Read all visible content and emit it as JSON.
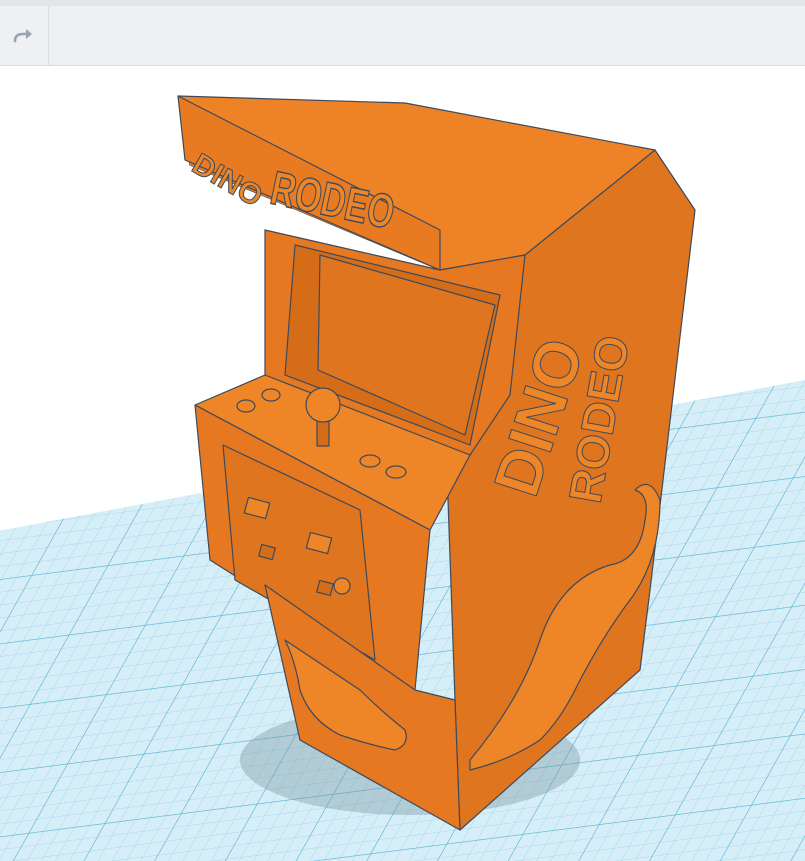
{
  "toolbar": {
    "redo_icon": "redo-arrow-icon"
  },
  "model": {
    "color": "#e87a22",
    "shade": "#d2691a",
    "dark": "#b85a14",
    "outline": "#3d4a5c",
    "marquee_logo_top": "DINO",
    "marquee_logo_bottom": "RODEO",
    "side_logo_top": "DINO",
    "side_logo_bottom": "RODEO"
  },
  "workplane": {
    "grid_color": "#7fc4de",
    "background": "#cfeaf5"
  }
}
